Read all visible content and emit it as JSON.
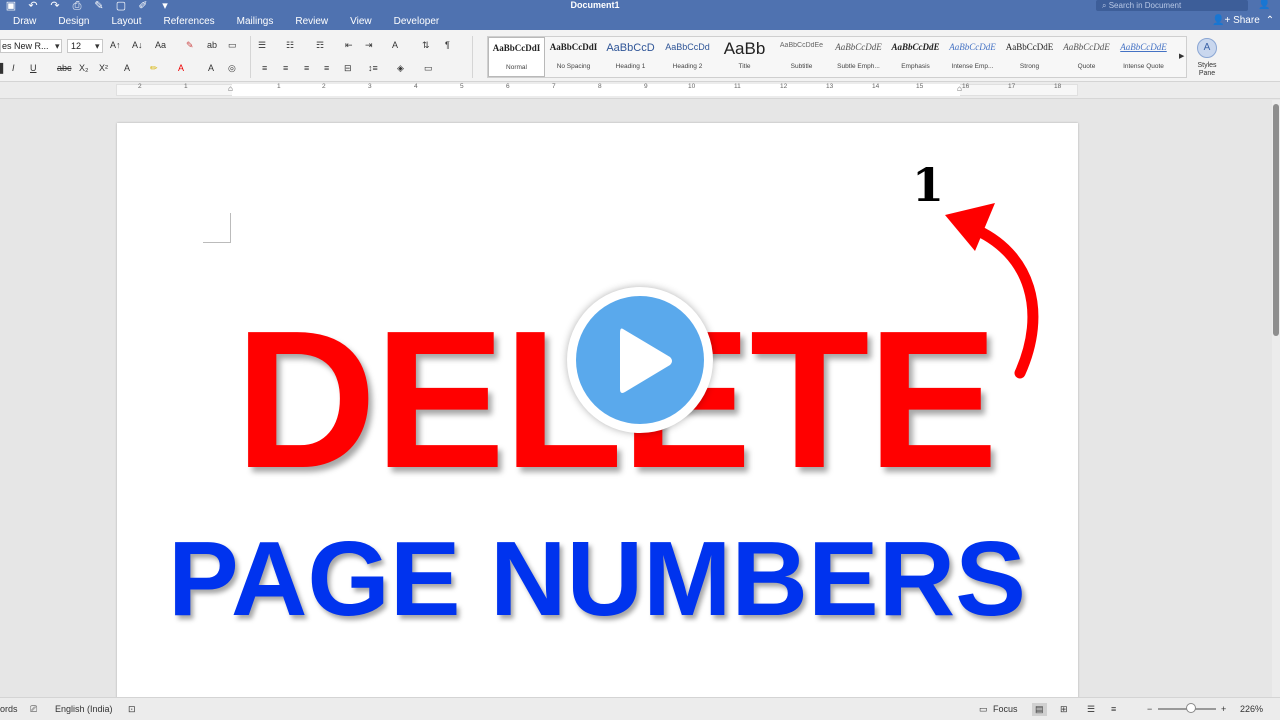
{
  "titlebar": {
    "doc_title": "Document1",
    "search_placeholder": "Search in Document",
    "share_label": "Share",
    "qat": [
      "save-icon",
      "undo-icon",
      "redo-icon",
      "print-icon",
      "edit-icon",
      "new-icon",
      "format-icon",
      "more-icon"
    ]
  },
  "tabs": [
    "Draw",
    "Design",
    "Layout",
    "References",
    "Mailings",
    "Review",
    "View",
    "Developer"
  ],
  "ribbon": {
    "font_name": "es New R...",
    "font_size": "12",
    "styles": [
      {
        "preview": "AaBbCcDdI",
        "name": "Normal"
      },
      {
        "preview": "AaBbCcDdI",
        "name": "No Spacing"
      },
      {
        "preview": "AaBbCcD",
        "name": "Heading 1"
      },
      {
        "preview": "AaBbCcDd",
        "name": "Heading 2"
      },
      {
        "preview": "AaBb",
        "name": "Title"
      },
      {
        "preview": "AaBbCcDdEe",
        "name": "Subtitle"
      },
      {
        "preview": "AaBbCcDdE",
        "name": "Subtle Emph..."
      },
      {
        "preview": "AaBbCcDdE",
        "name": "Emphasis"
      },
      {
        "preview": "AaBbCcDdE",
        "name": "Intense Emp..."
      },
      {
        "preview": "AaBbCcDdE",
        "name": "Strong"
      },
      {
        "preview": "AaBbCcDdE",
        "name": "Quote"
      },
      {
        "preview": "AaBbCcDdE",
        "name": "Intense Quote"
      }
    ],
    "styles_pane_label": "Styles Pane"
  },
  "ruler": {
    "numbers": [
      "2",
      "1",
      "1",
      "2",
      "3",
      "4",
      "5",
      "6",
      "7",
      "8",
      "9",
      "10",
      "11",
      "12",
      "13",
      "14",
      "15",
      "16",
      "17",
      "18"
    ]
  },
  "document": {
    "page_number": "1",
    "headline": "DELETE",
    "subheadline": "PAGE NUMBERS"
  },
  "status": {
    "words": "ords",
    "language": "English (India)",
    "focus": "Focus",
    "zoom": "226%"
  },
  "colors": {
    "titlebar": "#4f72b0",
    "headline": "#ff0000",
    "subheadline": "#0033ee",
    "play": "#5aa9ec"
  }
}
